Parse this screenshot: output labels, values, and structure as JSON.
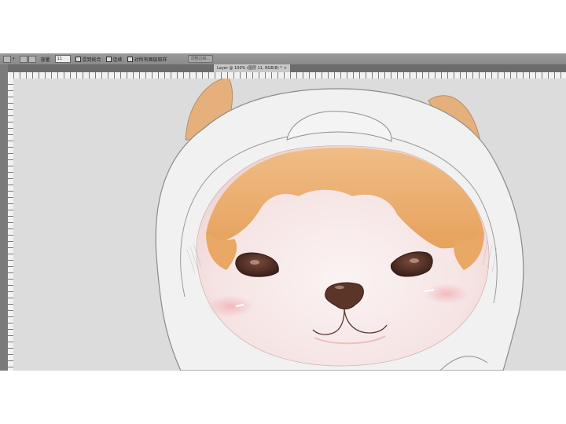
{
  "options_bar": {
    "opacity_label": "容量",
    "opacity_value": "11",
    "check_1_label": "混到统合",
    "check_2_label": "连续",
    "check_3_label": "对所有图层取样",
    "button_label": "调整边缘..."
  },
  "document_tab": {
    "label": "Layer @ 100% (图层 11, RGB/8) *",
    "close": "×"
  },
  "icons": {
    "tool": "magic-wand-icon",
    "tab_close": "close-icon"
  },
  "colors": {
    "hood": "#f1f1f1",
    "fur_orange": "#e8a562",
    "face": "#f7e9e8",
    "eye": "#4b2b23",
    "nose": "#5b3528"
  }
}
